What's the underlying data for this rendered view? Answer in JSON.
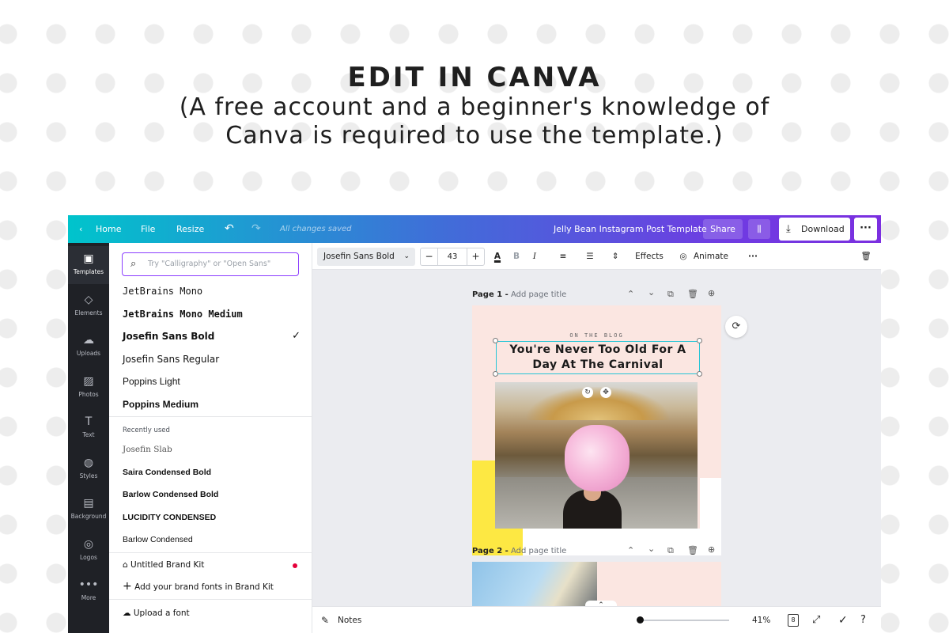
{
  "headline": {
    "title": "EDIT IN CANVA",
    "line1": "(A free account and a beginner's knowledge of",
    "line2": "Canva is required to use the template.)"
  },
  "topbar": {
    "home": "Home",
    "file": "File",
    "resize": "Resize",
    "status": "All changes saved",
    "doc_title": "Jelly Bean Instagram Post Template",
    "share": "Share",
    "download": "Download",
    "gradient_colors": [
      "#00c4cc",
      "#3f6fd8",
      "#7b2fe0"
    ]
  },
  "rail": [
    {
      "icon": "templates-icon",
      "glyph": "▣",
      "label": "Templates",
      "active": true
    },
    {
      "icon": "elements-icon",
      "glyph": "◇",
      "label": "Elements"
    },
    {
      "icon": "uploads-icon",
      "glyph": "☁",
      "label": "Uploads"
    },
    {
      "icon": "photos-icon",
      "glyph": "▨",
      "label": "Photos"
    },
    {
      "icon": "text-icon",
      "glyph": "T",
      "label": "Text"
    },
    {
      "icon": "styles-icon",
      "glyph": "◍",
      "label": "Styles"
    },
    {
      "icon": "background-icon",
      "glyph": "▤",
      "label": "Background"
    },
    {
      "icon": "logos-icon",
      "glyph": "◎",
      "label": "Logos"
    },
    {
      "icon": "more-icon",
      "glyph": "•••",
      "label": "More"
    }
  ],
  "font_panel": {
    "search_placeholder": "Try \"Calligraphy\" or \"Open Sans\"",
    "fonts": [
      {
        "name": "JetBrains Mono"
      },
      {
        "name": "JetBrains Mono Medium"
      },
      {
        "name": "Josefin Sans Bold",
        "selected": true
      },
      {
        "name": "Josefin Sans Regular"
      },
      {
        "name": "Poppins Light"
      },
      {
        "name": "Poppins Medium"
      }
    ],
    "recently_used_label": "Recently used",
    "recent_fonts": [
      {
        "name": "Josefin Slab"
      },
      {
        "name": "Saira Condensed Bold"
      },
      {
        "name": "Barlow Condensed Bold"
      },
      {
        "name": "LUCIDITY CONDENSED"
      },
      {
        "name": "Barlow Condensed"
      }
    ],
    "brand_kit": "Untitled Brand Kit",
    "add_brand_fonts": "Add your brand fonts in Brand Kit",
    "upload_font": "Upload a font"
  },
  "context_toolbar": {
    "font": "Josefin Sans Bold",
    "size": "43",
    "minus": "−",
    "plus": "+",
    "effects": "Effects",
    "animate": "Animate"
  },
  "canvas": {
    "page1_label": "Page 1 -",
    "page1_subtitle": "Add page title",
    "page2_label": "Page 2 -",
    "page2_subtitle": "Add page title",
    "kicker": "ON THE BLOG",
    "headline": "You're Never Too Old For A Day At The Carnival",
    "accent_colors": {
      "pink": "#fbe6e1",
      "yellow": "#fde843",
      "selection": "#26c5d6"
    }
  },
  "bottombar": {
    "notes": "Notes",
    "zoom": "41%",
    "page_count": "8",
    "zoom_level": 0.41
  }
}
